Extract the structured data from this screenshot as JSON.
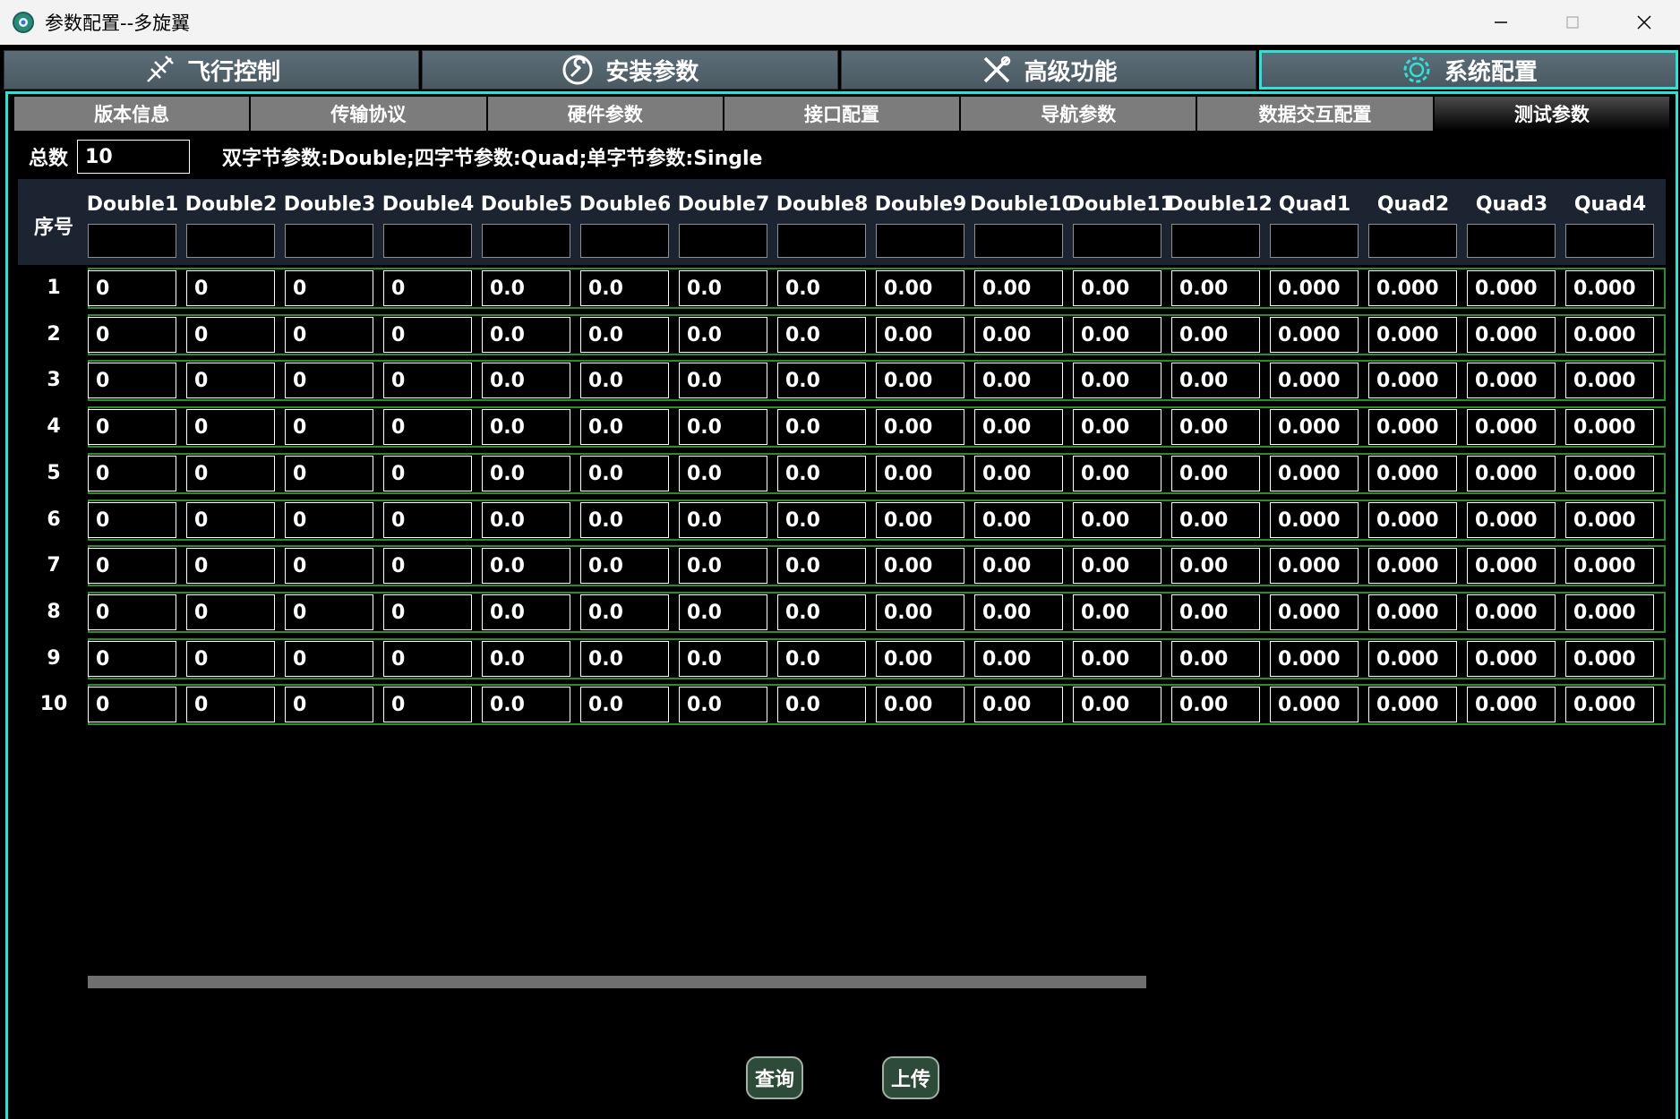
{
  "window": {
    "title": "参数配置--多旋翼"
  },
  "main_tabs": [
    {
      "label": "飞行控制",
      "icon": "airplane-icon"
    },
    {
      "label": "安装参数",
      "icon": "wrench-icon"
    },
    {
      "label": "高级功能",
      "icon": "tools-icon"
    },
    {
      "label": "系统配置",
      "icon": "gear-icon",
      "active": true
    }
  ],
  "sub_tabs": [
    {
      "label": "版本信息"
    },
    {
      "label": "传输协议"
    },
    {
      "label": "硬件参数"
    },
    {
      "label": "接口配置"
    },
    {
      "label": "导航参数"
    },
    {
      "label": "数据交互配置"
    },
    {
      "label": "测试参数",
      "active": true
    }
  ],
  "total": {
    "label": "总数",
    "value": "10"
  },
  "type_info": "双字节参数:Double;四字节参数:Quad;单字节参数:Single",
  "table": {
    "seq_header": "序号",
    "columns": [
      "Double1",
      "Double2",
      "Double3",
      "Double4",
      "Double5",
      "Double6",
      "Double7",
      "Double8",
      "Double9",
      "Double10",
      "Double11",
      "Double12",
      "Quad1",
      "Quad2",
      "Quad3",
      "Quad4"
    ],
    "rows": [
      {
        "num": "1",
        "cells": [
          "0",
          "0",
          "0",
          "0",
          "0.0",
          "0.0",
          "0.0",
          "0.0",
          "0.00",
          "0.00",
          "0.00",
          "0.00",
          "0.000",
          "0.000",
          "0.000",
          "0.000"
        ]
      },
      {
        "num": "2",
        "cells": [
          "0",
          "0",
          "0",
          "0",
          "0.0",
          "0.0",
          "0.0",
          "0.0",
          "0.00",
          "0.00",
          "0.00",
          "0.00",
          "0.000",
          "0.000",
          "0.000",
          "0.000"
        ]
      },
      {
        "num": "3",
        "cells": [
          "0",
          "0",
          "0",
          "0",
          "0.0",
          "0.0",
          "0.0",
          "0.0",
          "0.00",
          "0.00",
          "0.00",
          "0.00",
          "0.000",
          "0.000",
          "0.000",
          "0.000"
        ]
      },
      {
        "num": "4",
        "cells": [
          "0",
          "0",
          "0",
          "0",
          "0.0",
          "0.0",
          "0.0",
          "0.0",
          "0.00",
          "0.00",
          "0.00",
          "0.00",
          "0.000",
          "0.000",
          "0.000",
          "0.000"
        ]
      },
      {
        "num": "5",
        "cells": [
          "0",
          "0",
          "0",
          "0",
          "0.0",
          "0.0",
          "0.0",
          "0.0",
          "0.00",
          "0.00",
          "0.00",
          "0.00",
          "0.000",
          "0.000",
          "0.000",
          "0.000"
        ]
      },
      {
        "num": "6",
        "cells": [
          "0",
          "0",
          "0",
          "0",
          "0.0",
          "0.0",
          "0.0",
          "0.0",
          "0.00",
          "0.00",
          "0.00",
          "0.00",
          "0.000",
          "0.000",
          "0.000",
          "0.000"
        ]
      },
      {
        "num": "7",
        "cells": [
          "0",
          "0",
          "0",
          "0",
          "0.0",
          "0.0",
          "0.0",
          "0.0",
          "0.00",
          "0.00",
          "0.00",
          "0.00",
          "0.000",
          "0.000",
          "0.000",
          "0.000"
        ]
      },
      {
        "num": "8",
        "cells": [
          "0",
          "0",
          "0",
          "0",
          "0.0",
          "0.0",
          "0.0",
          "0.0",
          "0.00",
          "0.00",
          "0.00",
          "0.00",
          "0.000",
          "0.000",
          "0.000",
          "0.000"
        ]
      },
      {
        "num": "9",
        "cells": [
          "0",
          "0",
          "0",
          "0",
          "0.0",
          "0.0",
          "0.0",
          "0.0",
          "0.00",
          "0.00",
          "0.00",
          "0.00",
          "0.000",
          "0.000",
          "0.000",
          "0.000"
        ]
      },
      {
        "num": "10",
        "cells": [
          "0",
          "0",
          "0",
          "0",
          "0.0",
          "0.0",
          "0.0",
          "0.0",
          "0.00",
          "0.00",
          "0.00",
          "0.00",
          "0.000",
          "0.000",
          "0.000",
          "0.000"
        ]
      }
    ]
  },
  "buttons": {
    "query": "查询",
    "upload": "上传"
  },
  "colors": {
    "accent": "#2ee0d6",
    "row_border": "#2e8b2e",
    "header_bg": "#1c2431",
    "button_bg": "#2e4a38"
  }
}
